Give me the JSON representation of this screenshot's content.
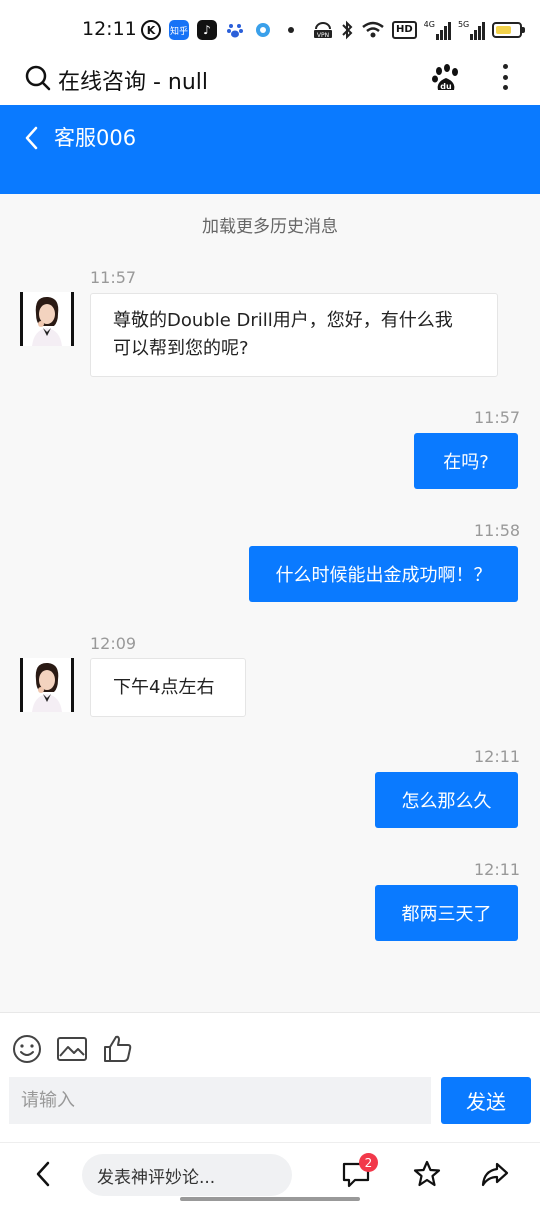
{
  "status_bar": {
    "time": "12:11",
    "left_icons": [
      "k-app-icon",
      "zhihu-icon",
      "douyin-icon",
      "baidu-paw-icon",
      "circle-app-icon",
      "dot-icon"
    ],
    "zhihu_label": "知乎",
    "right_icons": [
      "vpn-icon",
      "bluetooth-icon",
      "wifi-icon",
      "hd-icon",
      "signal-4g-icon",
      "signal-5g-icon",
      "battery-icon"
    ],
    "vpn_label": "VPN",
    "hd_label": "HD",
    "net1": "4G",
    "net2": "5G"
  },
  "browser": {
    "title": "在线咨询 - null"
  },
  "chat": {
    "title": "客服006",
    "load_more": "加载更多历史消息",
    "messages": [
      {
        "side": "left",
        "time": "11:57",
        "text_line1": "尊敬的Double Drill用户，您好，有什么我",
        "text_line2": "可以帮到您的呢?"
      },
      {
        "side": "right",
        "time": "11:57",
        "text": "在吗?"
      },
      {
        "side": "right",
        "time": "11:58",
        "text": "什么时候能出金成功啊！？"
      },
      {
        "side": "left",
        "time": "12:09",
        "text": "下午4点左右"
      },
      {
        "side": "right",
        "time": "12:11",
        "text": "怎么那么久"
      },
      {
        "side": "right",
        "time": "12:11",
        "text": "都两三天了"
      }
    ]
  },
  "input": {
    "placeholder": "请输入",
    "send_label": "发送",
    "tools": [
      "emoji-icon",
      "image-icon",
      "thumbs-up-icon"
    ]
  },
  "bottom_nav": {
    "comment_placeholder": "发表神评妙论...",
    "comment_count": "2"
  },
  "colors": {
    "accent": "#0a7aff",
    "badge": "#f2384a"
  }
}
